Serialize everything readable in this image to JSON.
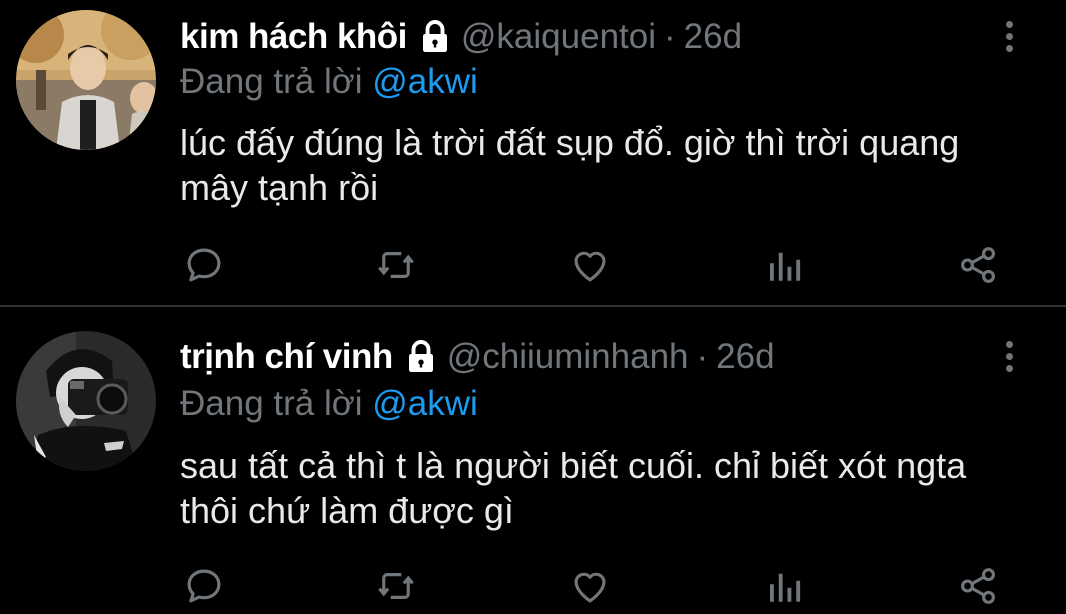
{
  "colors": {
    "background": "#000000",
    "primary_text": "#e7e9ea",
    "secondary_text": "#71767b",
    "link": "#1d9bf0",
    "divider": "#2f3336"
  },
  "tweets": [
    {
      "display_name": "kim hách khôi",
      "handle": "@kaiquentoi",
      "separator": "·",
      "time": "26d",
      "replying_label": "Đang trả lời",
      "replying_to": "@akwi",
      "text": "lúc đấy đúng là trời đất sụp đổ. giờ thì trời quang mây tạnh rồi",
      "locked": true,
      "icons": [
        "lock-icon",
        "more-icon",
        "reply-icon",
        "retweet-icon",
        "like-icon",
        "stats-icon",
        "share-icon"
      ]
    },
    {
      "display_name": "trịnh chí vinh",
      "handle": "@chiiuminhanh",
      "separator": "·",
      "time": "26d",
      "replying_label": "Đang trả lời",
      "replying_to": "@akwi",
      "text": "sau tất cả thì t là người biết cuối. chỉ biết xót ngta thôi chứ làm được gì",
      "locked": true,
      "icons": [
        "lock-icon",
        "more-icon",
        "reply-icon",
        "retweet-icon",
        "like-icon",
        "stats-icon",
        "share-icon"
      ]
    }
  ]
}
